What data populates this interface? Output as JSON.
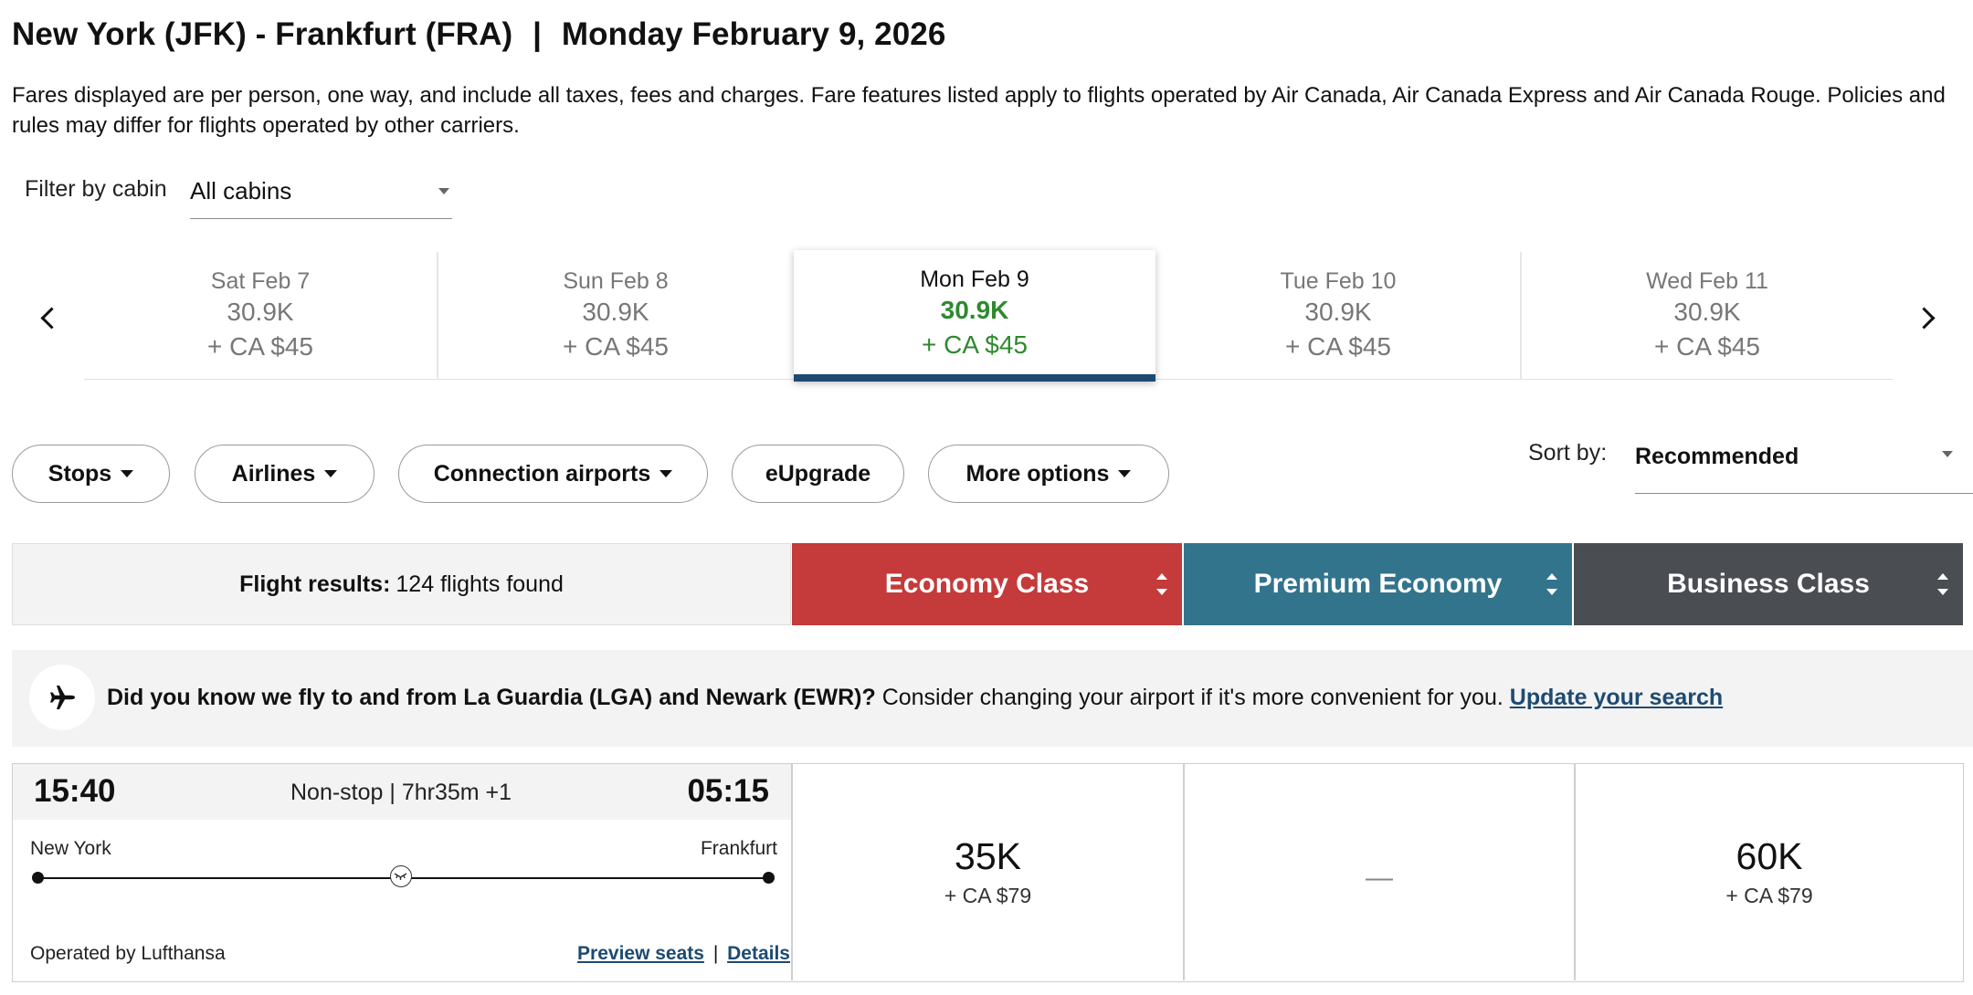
{
  "header": {
    "route": "New York (JFK) - Frankfurt (FRA)",
    "separator": "|",
    "date": "Monday February 9, 2026",
    "note": "Fares displayed are per person, one way, and include all taxes, fees and charges. Fare features listed apply to flights operated by Air Canada, Air Canada Express and Air Canada Rouge. Policies and rules may differ for flights operated by other carriers."
  },
  "filter": {
    "label": "Filter by cabin",
    "value": "All cabins"
  },
  "dates": [
    {
      "day": "Sat Feb 7",
      "points": "30.9K",
      "tax": "+ CA $45",
      "selected": false
    },
    {
      "day": "Sun Feb 8",
      "points": "30.9K",
      "tax": "+ CA $45",
      "selected": false
    },
    {
      "day": "Mon Feb 9",
      "points": "30.9K",
      "tax": "+ CA $45",
      "selected": true
    },
    {
      "day": "Tue Feb 10",
      "points": "30.9K",
      "tax": "+ CA $45",
      "selected": false
    },
    {
      "day": "Wed Feb 11",
      "points": "30.9K",
      "tax": "+ CA $45",
      "selected": false
    }
  ],
  "filters": {
    "stops": "Stops",
    "airlines": "Airlines",
    "connection_airports": "Connection airports",
    "eupgrade": "eUpgrade",
    "more_options": "More options"
  },
  "sort": {
    "label": "Sort by:",
    "value": "Recommended"
  },
  "results": {
    "label": "Flight results:",
    "count": "124 flights found"
  },
  "cabins": {
    "economy": {
      "label": "Economy Class",
      "color": "#c53a3a"
    },
    "premium": {
      "label": "Premium Economy",
      "color": "#33748d"
    },
    "business": {
      "label": "Business Class",
      "color": "#4a4d52"
    }
  },
  "banner": {
    "bold": "Did you know we fly to and from La Guardia (LGA) and Newark (EWR)?",
    "text": "Consider changing your airport if it's more convenient for you.",
    "link": "Update your search"
  },
  "flight": {
    "depart_time": "15:40",
    "arrive_time": "05:15",
    "duration": "Non-stop | 7hr35m +1",
    "origin": "New York",
    "destination": "Frankfurt",
    "operated": "Operated by Lufthansa",
    "preview_link": "Preview seats",
    "links_sep": "|",
    "details_link": "Details",
    "economy": {
      "points": "35K",
      "tax": "+ CA $79"
    },
    "premium": {
      "points": "—"
    },
    "business": {
      "points": "60K",
      "tax": "+ CA $79"
    }
  }
}
